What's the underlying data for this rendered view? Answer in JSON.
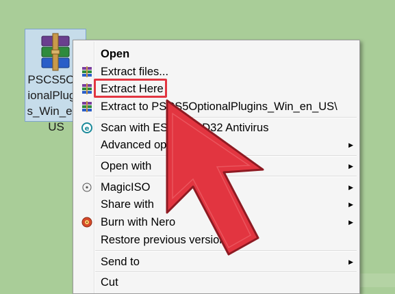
{
  "desktop": {
    "file_icon": {
      "icon": "winrar-archive-icon",
      "label": "PSCS5OptionalPlugins_Win_en_US"
    }
  },
  "context_menu": {
    "items": [
      {
        "label": "Open",
        "bold": true,
        "icon": "",
        "submenu": false
      },
      {
        "label": "Extract files...",
        "icon": "winrar-books-icon",
        "submenu": false
      },
      {
        "label": "Extract Here",
        "icon": "winrar-books-icon",
        "submenu": false,
        "highlighted": true
      },
      {
        "label": "Extract to PSCS5OptionalPlugins_Win_en_US\\",
        "icon": "winrar-books-icon",
        "submenu": false
      },
      {
        "label": "Scan with ESET NOD32 Antivirus",
        "icon": "eset-icon",
        "submenu": false
      },
      {
        "label": "Advanced options",
        "icon": "",
        "submenu": true
      },
      {
        "label": "Open with",
        "icon": "",
        "submenu": true
      },
      {
        "label": "MagicISO",
        "icon": "magiciso-icon",
        "submenu": true
      },
      {
        "label": "Share with",
        "icon": "",
        "submenu": true
      },
      {
        "label": "Burn with Nero",
        "icon": "nero-icon",
        "submenu": true
      },
      {
        "label": "Restore previous versions",
        "icon": "",
        "submenu": false
      },
      {
        "label": "Send to",
        "icon": "",
        "submenu": true
      },
      {
        "label": "Cut",
        "icon": "",
        "submenu": false
      }
    ]
  },
  "annotation": {
    "pointer": "red-arrow-cursor-icon",
    "highlight_color": "#e23540"
  },
  "colors": {
    "desktop_bg": "#a9cd98",
    "menu_bg": "#f5f5f5",
    "accent_red": "#e23540"
  }
}
